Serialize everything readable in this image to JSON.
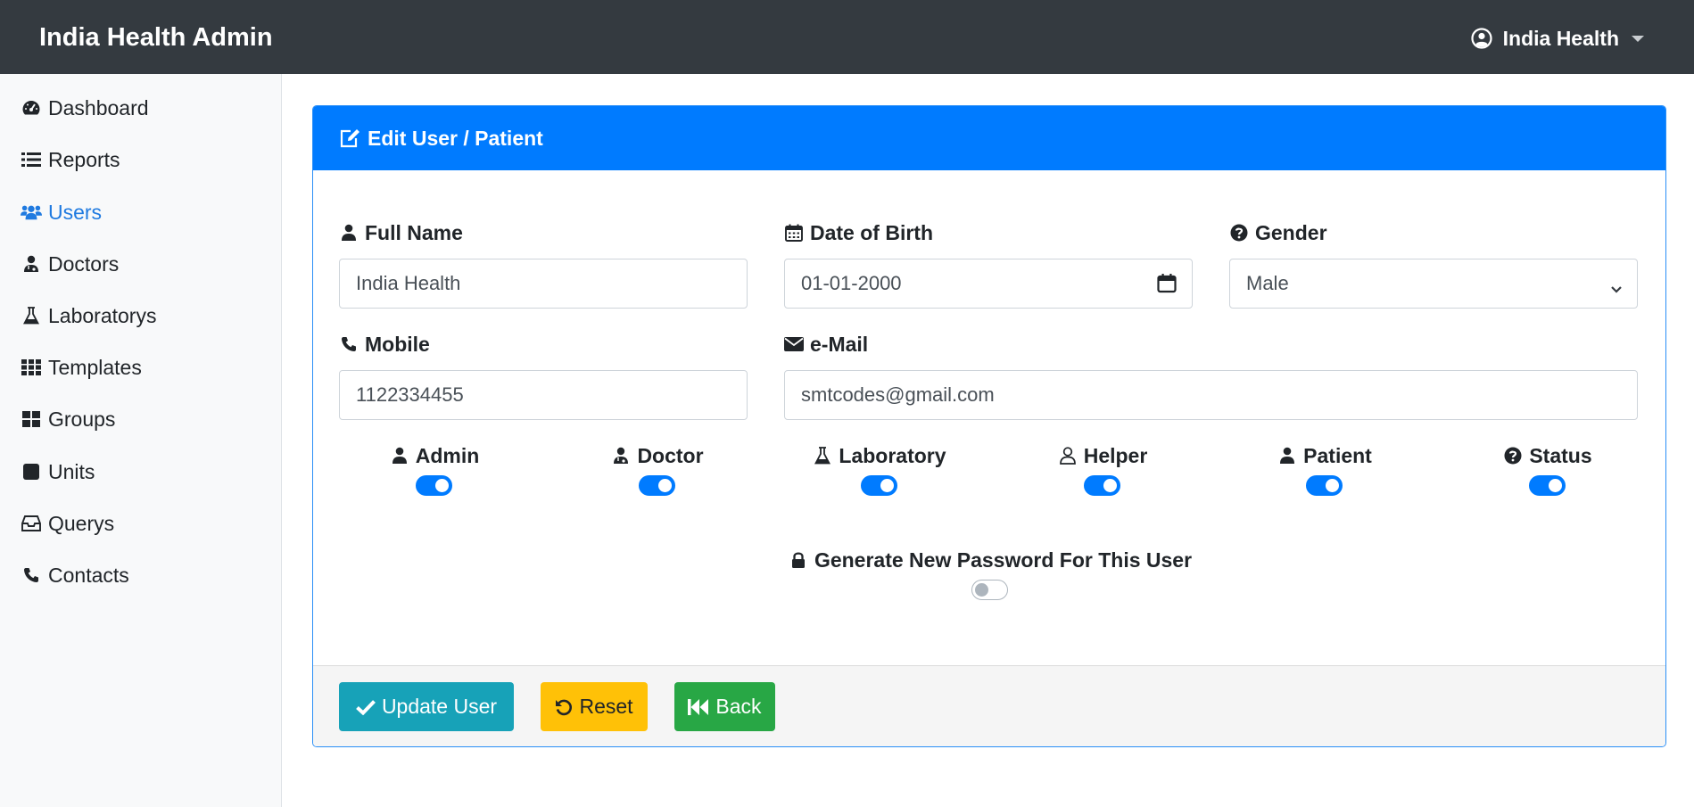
{
  "app": {
    "title": "India Health Admin"
  },
  "user_menu": {
    "name": "India Health",
    "icon": "user-circle-icon"
  },
  "sidebar": {
    "items": [
      {
        "label": "Dashboard",
        "icon": "tachometer-icon",
        "active": false
      },
      {
        "label": "Reports",
        "icon": "list-icon",
        "active": false
      },
      {
        "label": "Users",
        "icon": "users-icon",
        "active": true
      },
      {
        "label": "Doctors",
        "icon": "user-md-icon",
        "active": false
      },
      {
        "label": "Laboratorys",
        "icon": "flask-icon",
        "active": false
      },
      {
        "label": "Templates",
        "icon": "th-icon",
        "active": false
      },
      {
        "label": "Groups",
        "icon": "th-large-icon",
        "active": false
      },
      {
        "label": "Units",
        "icon": "square-icon",
        "active": false
      },
      {
        "label": "Querys",
        "icon": "inbox-icon",
        "active": false
      },
      {
        "label": "Contacts",
        "icon": "phone-icon",
        "active": false
      }
    ]
  },
  "card": {
    "title": "Edit User / Patient",
    "title_icon": "edit-icon"
  },
  "form": {
    "full_name": {
      "label": "Full Name",
      "value": "India Health",
      "icon": "user-icon"
    },
    "dob": {
      "label": "Date of Birth",
      "value": "01-01-2000",
      "icon": "calendar-icon"
    },
    "gender": {
      "label": "Gender",
      "value": "Male",
      "icon": "question-circle-icon"
    },
    "mobile": {
      "label": "Mobile",
      "value": "1122334455",
      "icon": "phone-icon"
    },
    "email": {
      "label": "e-Mail",
      "value": "smtcodes@gmail.com",
      "icon": "envelope-icon"
    }
  },
  "roles": [
    {
      "label": "Admin",
      "icon": "user-icon",
      "checked": true
    },
    {
      "label": "Doctor",
      "icon": "user-md-icon",
      "checked": true
    },
    {
      "label": "Laboratory",
      "icon": "flask-icon",
      "checked": true
    },
    {
      "label": "Helper",
      "icon": "user-outline-icon",
      "checked": true
    },
    {
      "label": "Patient",
      "icon": "user-icon",
      "checked": true
    },
    {
      "label": "Status",
      "icon": "question-circle-icon",
      "checked": true
    }
  ],
  "password": {
    "label": "Generate New Password For This User",
    "icon": "lock-icon",
    "checked": false
  },
  "buttons": {
    "update": "Update User",
    "reset": "Reset",
    "back": "Back"
  },
  "colors": {
    "navbar": "#343a40",
    "primary": "#007bff",
    "info": "#17a2b8",
    "warning": "#ffc107",
    "success": "#28a745"
  }
}
